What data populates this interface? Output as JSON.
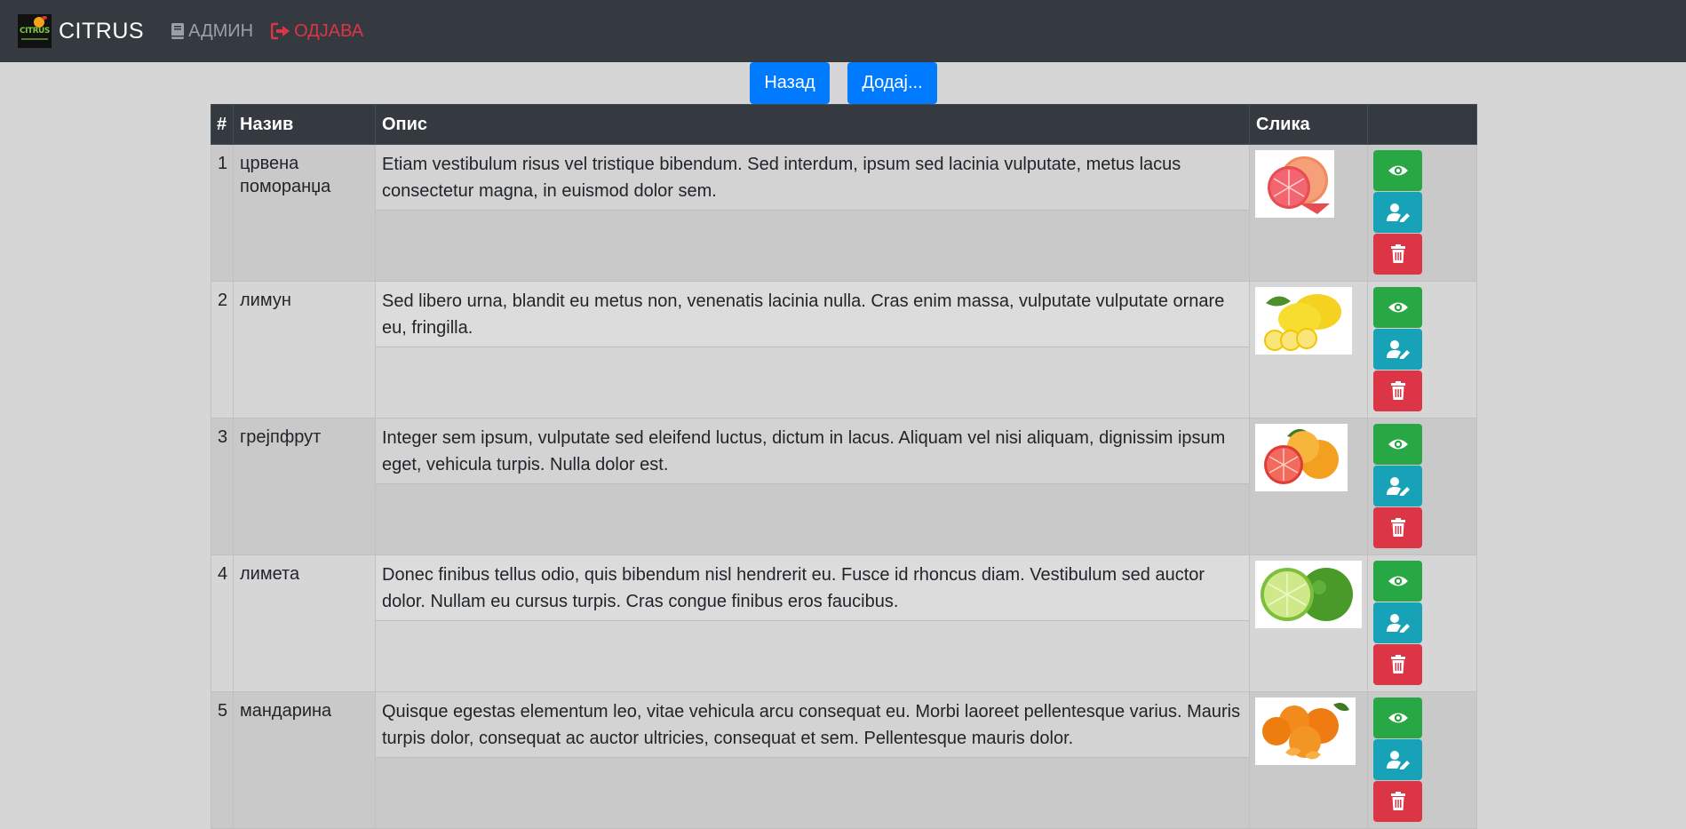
{
  "navbar": {
    "brand_text": "CITRUS",
    "logo_word": "CITRUS",
    "admin_label": "АДМИН",
    "logout_label": "ОДЈАВА"
  },
  "toolbar": {
    "back_label": "Назад",
    "add_label": "Додај..."
  },
  "table": {
    "headers": {
      "num": "#",
      "name": "Назив",
      "description": "Опис",
      "image": "Слика",
      "actions": ""
    },
    "rows": [
      {
        "num": "1",
        "name_line1": "црвена",
        "name_line2": "поморанџа",
        "description": "Etiam vestibulum risus vel tristique bibendum. Sed interdum, ipsum sed lacinia vulputate, metus lacus consectetur magna, in euismod dolor sem.",
        "image_icon": "blood-orange-image"
      },
      {
        "num": "2",
        "name_line1": "лимун",
        "name_line2": "",
        "description": "Sed libero urna, blandit eu metus non, venenatis lacinia nulla. Cras enim massa, vulputate vulputate ornare eu, fringilla.",
        "image_icon": "lemon-image"
      },
      {
        "num": "3",
        "name_line1": "грејпфрут",
        "name_line2": "",
        "description": "Integer sem ipsum, vulputate sed eleifend luctus, dictum in lacus. Aliquam vel nisi aliquam, dignissim ipsum eget, vehicula turpis. Nulla dolor est.",
        "image_icon": "grapefruit-image"
      },
      {
        "num": "4",
        "name_line1": "лимета",
        "name_line2": "",
        "description": "Donec finibus tellus odio, quis bibendum nisl hendrerit eu. Fusce id rhoncus diam. Vestibulum sed auctor dolor. Nullam eu cursus turpis. Cras congue finibus eros faucibus.",
        "image_icon": "lime-image"
      },
      {
        "num": "5",
        "name_line1": "мандарина",
        "name_line2": "",
        "description": "Quisque egestas elementum leo, vitae vehicula arcu consequat eu. Morbi laoreet pellentesque varius. Mauris turpis dolor, consequat ac auctor ultricies, consequat et sem. Pellentesque mauris dolor.",
        "image_icon": "mandarin-image"
      }
    ]
  },
  "colors": {
    "navbar": "#343a40",
    "primary": "#007bff",
    "view": "#28a745",
    "edit": "#17a2b8",
    "delete": "#dc3545"
  }
}
